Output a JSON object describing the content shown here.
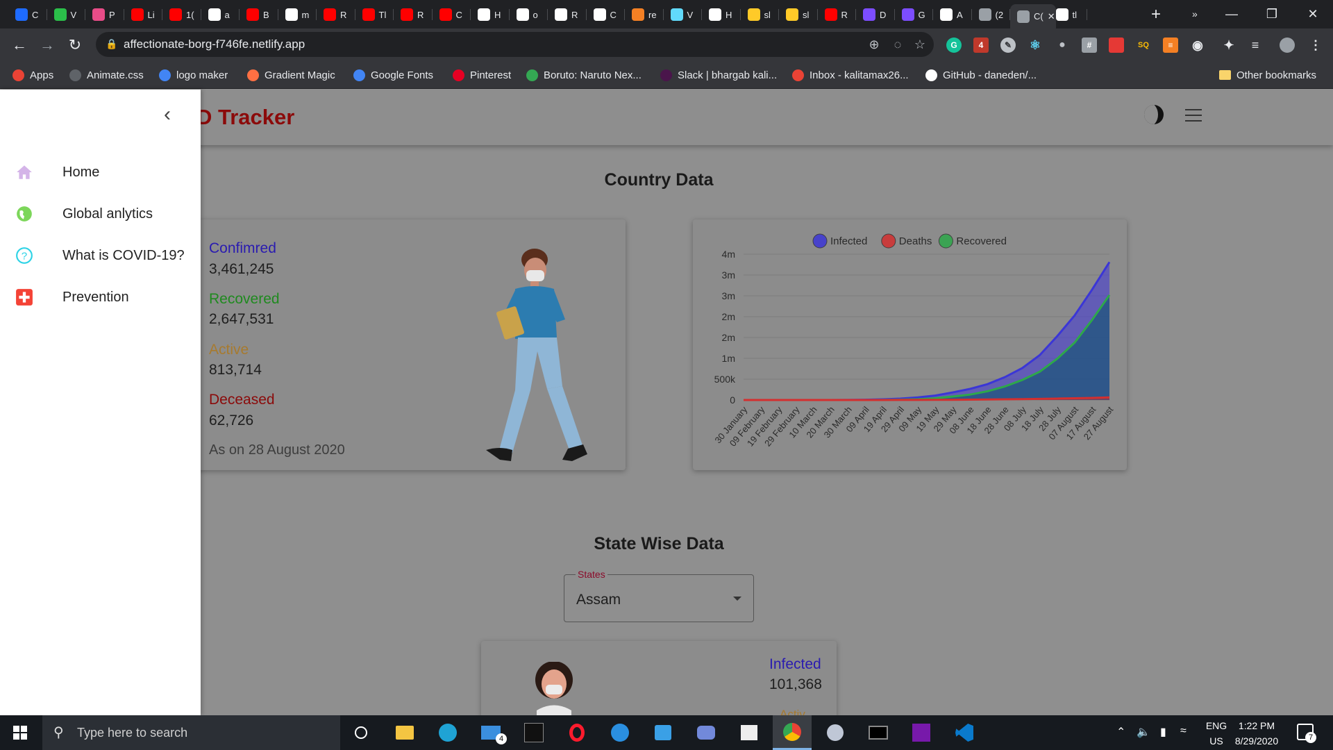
{
  "browser": {
    "tabs": [
      {
        "letter": "C",
        "color": "#1e6bff"
      },
      {
        "letter": "V",
        "color": "#2bbf4a"
      },
      {
        "letter": "P",
        "color": "#e84c88"
      },
      {
        "letter": "Li",
        "color": "#ff0000"
      },
      {
        "letter": "1(",
        "color": "#ff0000"
      },
      {
        "letter": "a",
        "color": "#ffffff"
      },
      {
        "letter": "B",
        "color": "#ff0000"
      },
      {
        "letter": "m",
        "color": "#ffffff"
      },
      {
        "letter": "R",
        "color": "#ff0000"
      },
      {
        "letter": "Tl",
        "color": "#ff0000"
      },
      {
        "letter": "R",
        "color": "#ff0000"
      },
      {
        "letter": "C",
        "color": "#ff0000"
      },
      {
        "letter": "H",
        "color": "#ffffff"
      },
      {
        "letter": "o",
        "color": "#ffffff"
      },
      {
        "letter": "R",
        "color": "#ffffff"
      },
      {
        "letter": "C",
        "color": "#ffffff"
      },
      {
        "letter": "re",
        "color": "#f48024"
      },
      {
        "letter": "V",
        "color": "#61dafb"
      },
      {
        "letter": "H",
        "color": "#ffffff"
      },
      {
        "letter": "sl",
        "color": "#ffca28"
      },
      {
        "letter": "sl",
        "color": "#ffca28"
      },
      {
        "letter": "R",
        "color": "#ff0000"
      },
      {
        "letter": "D",
        "color": "#7c4dff"
      },
      {
        "letter": "G",
        "color": "#7c4dff"
      },
      {
        "letter": "A",
        "color": "#ffffff"
      },
      {
        "letter": "(2",
        "color": "#9aa0a6"
      },
      {
        "letter": "C(",
        "color": "#9aa0a6"
      },
      {
        "letter": "tl",
        "color": "#ffffff"
      }
    ],
    "url": "affectionate-borg-f746fe.netlify.app",
    "bookmarks": [
      {
        "label": "Apps",
        "color": "#ea4335"
      },
      {
        "label": "Animate.css",
        "color": "#5f6368"
      },
      {
        "label": "logo maker",
        "color": "#4285f4"
      },
      {
        "label": "Gradient Magic",
        "color": "#ff7043"
      },
      {
        "label": "Google Fonts",
        "color": "#4285f4"
      },
      {
        "label": "Pinterest",
        "color": "#e60023"
      },
      {
        "label": "Boruto: Naruto Nex...",
        "color": "#34a853"
      },
      {
        "label": "Slack | bhargab kali...",
        "color": "#4a154b"
      },
      {
        "label": "Inbox - kalitamax26...",
        "color": "#ea4335"
      },
      {
        "label": "GitHub - daneden/...",
        "color": "#ffffff"
      }
    ],
    "more_bookmarks": "»",
    "other_bookmarks": "Other bookmarks"
  },
  "app": {
    "brand": "D Tracker",
    "sidebar": {
      "items": [
        {
          "label": "Home",
          "icon": "home-icon",
          "color": "#d4b4e8"
        },
        {
          "label": "Global anlytics",
          "icon": "globe-icon",
          "color": "#7cd65a"
        },
        {
          "label": "What is COVID-19?",
          "icon": "help-icon",
          "color": "#2ed3e6"
        },
        {
          "label": "Prevention",
          "icon": "medical-cross-icon",
          "color": "#f44336"
        }
      ]
    },
    "country": {
      "title": "Country Data",
      "stats": [
        {
          "label": "Confimred",
          "value": "3,461,245",
          "color": "#2a1bb0"
        },
        {
          "label": "Recovered",
          "value": "2,647,531",
          "color": "#1f8a1f"
        },
        {
          "label": "Active",
          "value": "813,714",
          "color": "#a77a2e"
        },
        {
          "label": "Deceased",
          "value": "62,726",
          "color": "#8b0a0a"
        }
      ],
      "as_on": "As on 28 August 2020"
    },
    "state": {
      "title": "State Wise Data",
      "select_label": "States",
      "selected": "Assam",
      "infected_label": "Infected",
      "infected_value": "101,368",
      "partial_label": "Activ"
    }
  },
  "chart_data": {
    "type": "area",
    "legend": [
      "Infected",
      "Deaths",
      "Recovered"
    ],
    "legend_placement": "top",
    "colors": {
      "Infected": "#3b36d6",
      "Deaths": "#d32f2f",
      "Recovered": "#2ea84a"
    },
    "y_tick_labels": [
      "0",
      "500k",
      "1m",
      "2m",
      "2m",
      "3m",
      "3m",
      "4m"
    ],
    "ylim": [
      0,
      3500000
    ],
    "x": [
      "30 January",
      "09 February",
      "19 February",
      "29 February",
      "10 March",
      "20 March",
      "30 March",
      "09 April",
      "19 April",
      "29 April",
      "09 May",
      "19 May",
      "29 May",
      "08 June",
      "18 June",
      "28 June",
      "08 July",
      "18 July",
      "28 July",
      "07 August",
      "17 August",
      "27 August"
    ],
    "series": [
      {
        "name": "Infected",
        "values": [
          1,
          3,
          3,
          3,
          50,
          250,
          1250,
          6700,
          17000,
          33600,
          62800,
          106750,
          182000,
          266600,
          380500,
          549000,
          767000,
          1077000,
          1531000,
          2027000,
          2647000,
          3310000
        ]
      },
      {
        "name": "Deaths",
        "values": [
          0,
          0,
          0,
          0,
          0,
          4,
          32,
          250,
          560,
          1080,
          2100,
          3300,
          5200,
          7500,
          12600,
          16500,
          21100,
          26800,
          34200,
          41600,
          51000,
          61500
        ]
      },
      {
        "name": "Recovered",
        "values": [
          0,
          0,
          3,
          3,
          4,
          20,
          100,
          650,
          2850,
          8300,
          19300,
          41000,
          82600,
          130000,
          210000,
          325000,
          482000,
          680000,
          990000,
          1377000,
          1920000,
          2520000
        ]
      }
    ]
  },
  "taskbar": {
    "search_placeholder": "Type here to search",
    "lang": "ENG",
    "region": "US",
    "time": "1:22 PM",
    "date": "8/29/2020",
    "notif_count": "7",
    "mail_badge": "4"
  }
}
